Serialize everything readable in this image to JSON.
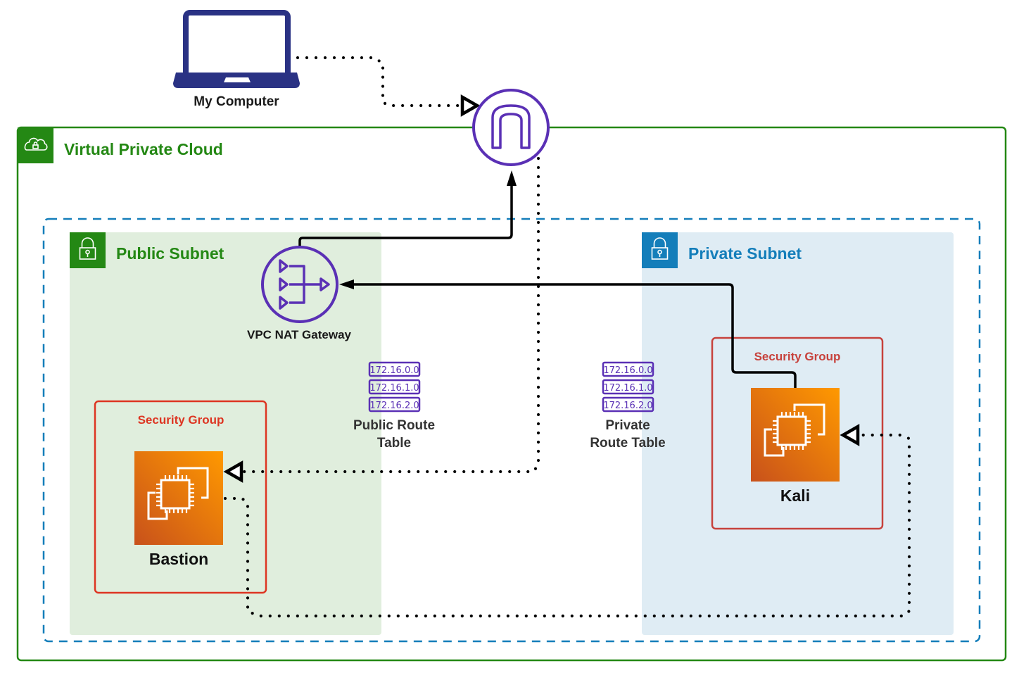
{
  "nodes": {
    "my_computer": {
      "label": "My Computer",
      "icon": "laptop-icon"
    },
    "internet_gateway": {
      "label": "",
      "icon": "internet-gateway-icon"
    },
    "vpc": {
      "label": "Virtual Private Cloud",
      "icon": "cloud-lock-icon"
    },
    "public_subnet": {
      "label": "Public Subnet",
      "icon": "padlock-icon"
    },
    "private_subnet": {
      "label": "Private Subnet",
      "icon": "padlock-icon"
    },
    "nat_gateway": {
      "label": "VPC NAT Gateway",
      "icon": "nat-gateway-icon"
    },
    "public_route_table": {
      "label_line1": "Public Route",
      "label_line2": "Table",
      "entries": [
        "172.16.0.0",
        "172.16.1.0",
        "172.16.2.0"
      ]
    },
    "private_route_table": {
      "label_line1": "Private",
      "label_line2": "Route Table",
      "entries": [
        "172.16.0.0",
        "172.16.1.0",
        "172.16.2.0"
      ]
    },
    "bastion_sg": {
      "label": "Security Group"
    },
    "kali_sg": {
      "label": "Security Group"
    },
    "bastion": {
      "label": "Bastion",
      "icon": "ec2-instance-icon"
    },
    "kali": {
      "label": "Kali",
      "icon": "ec2-instance-icon"
    }
  },
  "edges": [
    {
      "from": "My Computer",
      "to": "Internet Gateway",
      "style": "dotted",
      "arrow": "open-triangle"
    },
    {
      "from": "Internet Gateway",
      "to": "Bastion",
      "style": "dotted",
      "arrow": "open-triangle"
    },
    {
      "from": "Bastion",
      "to": "Kali",
      "style": "dotted",
      "arrow": "open-triangle"
    },
    {
      "from": "Kali",
      "to": "VPC NAT Gateway",
      "style": "solid",
      "arrow": "filled"
    },
    {
      "from": "VPC NAT Gateway",
      "to": "Internet Gateway",
      "style": "solid",
      "arrow": "filled"
    }
  ],
  "colors": {
    "vpc_green": "#248814",
    "subnet_dash_blue": "#147EBA",
    "public_subnet_fill": "#E0EEDD",
    "private_subnet_fill": "#DFECF4",
    "private_blue": "#147EBA",
    "security_group_red": "#DD3522",
    "aws_purple": "#5A30B5",
    "laptop_navy": "#2A3284",
    "ec2_orange_start": "#C8511B",
    "ec2_orange_end": "#FF9900"
  }
}
